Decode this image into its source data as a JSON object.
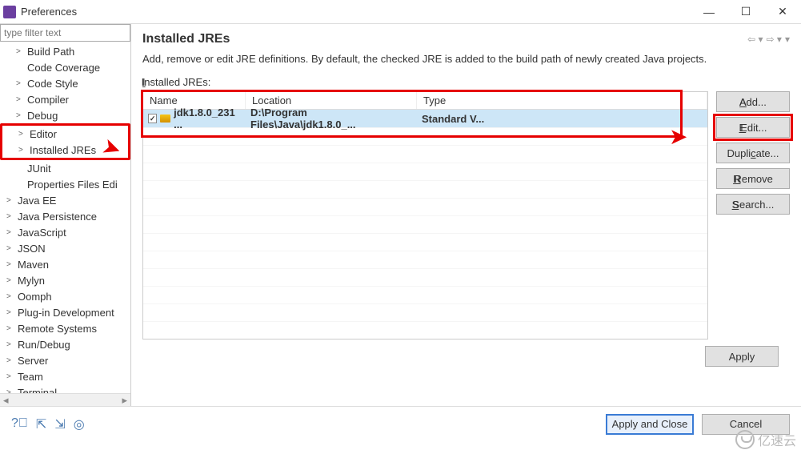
{
  "window": {
    "title": "Preferences",
    "minimize": "—",
    "maximize": "☐",
    "close": "✕"
  },
  "sidebar": {
    "filter_placeholder": "type filter text",
    "items": [
      {
        "label": "Build Path",
        "expandable": true,
        "indent": true
      },
      {
        "label": "Code Coverage",
        "expandable": false,
        "indent": true
      },
      {
        "label": "Code Style",
        "expandable": true,
        "indent": true
      },
      {
        "label": "Compiler",
        "expandable": true,
        "indent": true
      },
      {
        "label": "Debug",
        "expandable": true,
        "indent": true
      },
      {
        "label": "Editor",
        "expandable": true,
        "indent": true,
        "hl": true
      },
      {
        "label": "Installed JREs",
        "expandable": true,
        "indent": true,
        "hl": true
      },
      {
        "label": "JUnit",
        "expandable": false,
        "indent": true
      },
      {
        "label": "Properties Files Edi",
        "expandable": false,
        "indent": true
      },
      {
        "label": "Java EE",
        "expandable": true,
        "indent": false
      },
      {
        "label": "Java Persistence",
        "expandable": true,
        "indent": false
      },
      {
        "label": "JavaScript",
        "expandable": true,
        "indent": false
      },
      {
        "label": "JSON",
        "expandable": true,
        "indent": false
      },
      {
        "label": "Maven",
        "expandable": true,
        "indent": false
      },
      {
        "label": "Mylyn",
        "expandable": true,
        "indent": false
      },
      {
        "label": "Oomph",
        "expandable": true,
        "indent": false
      },
      {
        "label": "Plug-in Development",
        "expandable": true,
        "indent": false
      },
      {
        "label": "Remote Systems",
        "expandable": true,
        "indent": false
      },
      {
        "label": "Run/Debug",
        "expandable": true,
        "indent": false
      },
      {
        "label": "Server",
        "expandable": true,
        "indent": false
      },
      {
        "label": "Team",
        "expandable": true,
        "indent": false
      },
      {
        "label": "Terminal",
        "expandable": true,
        "indent": false
      }
    ]
  },
  "content": {
    "title": "Installed JREs",
    "description": "Add, remove or edit JRE definitions. By default, the checked JRE is added to the build path of newly created Java projects.",
    "section_label": "Installed JREs:",
    "columns": {
      "name": "Name",
      "location": "Location",
      "type": "Type"
    },
    "rows": [
      {
        "checked": true,
        "name": "jdk1.8.0_231 ...",
        "location": "D:\\Program Files\\Java\\jdk1.8.0_...",
        "type": "Standard V..."
      }
    ],
    "buttons": {
      "add": "Add...",
      "edit": "Edit...",
      "duplicate": "Duplicate...",
      "remove": "Remove",
      "search": "Search..."
    },
    "apply": "Apply"
  },
  "footer": {
    "apply_close": "Apply and Close",
    "cancel": "Cancel"
  },
  "watermark": "亿速云"
}
